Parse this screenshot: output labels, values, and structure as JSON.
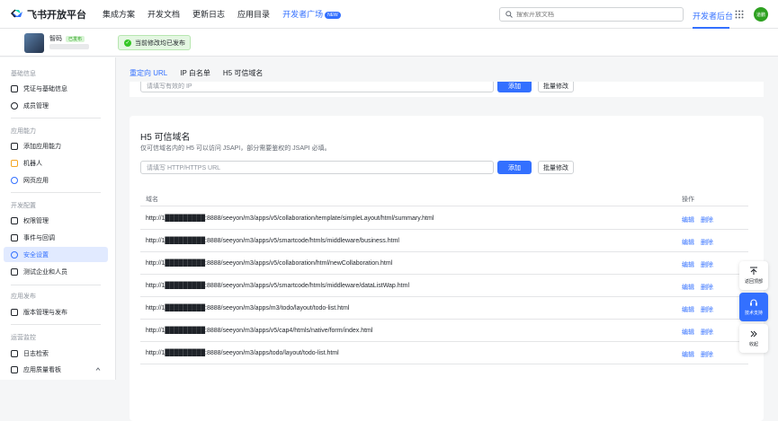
{
  "topbar": {
    "brand": "飞书开放平台",
    "nav": [
      "集成方案",
      "开发文档",
      "更新日志",
      "应用目录"
    ],
    "dev_square": "开发者广场",
    "new_badge": "NEW",
    "search_placeholder": "搜索开放文档",
    "backend": "开发者后台",
    "avatar_text": "道鹏"
  },
  "app": {
    "name": "智码",
    "status": "已发布",
    "toast": "当前修改均已发布"
  },
  "sidebar": {
    "sections": [
      {
        "title": "基础信息",
        "items": [
          "凭证与基础信息",
          "成员管理"
        ]
      },
      {
        "title": "应用能力",
        "items": [
          "添加应用能力",
          "机器人",
          "网页应用"
        ]
      },
      {
        "title": "开发配置",
        "items": [
          "权限管理",
          "事件与回调",
          "安全设置",
          "测试企业和人员"
        ]
      },
      {
        "title": "应用发布",
        "items": [
          "版本管理与发布"
        ]
      },
      {
        "title": "运营监控",
        "items": [
          "日志检索",
          "应用质量看板"
        ]
      }
    ],
    "active": "安全设置"
  },
  "tabs": [
    "重定向 URL",
    "IP 白名单",
    "H5 可信域名"
  ],
  "ip_section": {
    "placeholder": "请填写有效的 IP",
    "add": "添加",
    "batch": "批量修改"
  },
  "h5_section": {
    "title": "H5 可信域名",
    "description": "仅可信域名内的 H5 可以访问 JSAPI，部分需要鉴权的 JSAPI 必填。",
    "placeholder": "请填写 HTTP/HTTPS URL",
    "add": "添加",
    "batch": "批量修改",
    "col_domain": "域名",
    "col_action": "操作",
    "edit": "编辑",
    "delete": "删除",
    "rows": [
      "http://1█████████:8888/seeyon/m3/apps/v5/collaboration/template/simpleLayout/html/summary.html",
      "http://1█████████:8888/seeyon/m3/apps/v5/smartcode/htmls/middleware/business.html",
      "http://1█████████:8888/seeyon/m3/apps/v5/collaboration/html/newCollaboration.html",
      "http://1█████████:8888/seeyon/m3/apps/v5/smartcode/htmls/middleware/dataListWap.html",
      "http://1█████████:8888/seeyon/m3/apps/m3/todo/layout/todo-list.html",
      "http://1█████████:8888/seeyon/m3/apps/v5/cap4/htmls/native/form/index.html",
      "http://1█████████:8888/seeyon/m3/apps/todo/layout/todo-list.html"
    ]
  },
  "floating": {
    "top": "返回顶部",
    "support": "技术支持",
    "collapse": "收起"
  },
  "colors": {
    "accent": "#3370ff",
    "success": "#2ea121"
  }
}
